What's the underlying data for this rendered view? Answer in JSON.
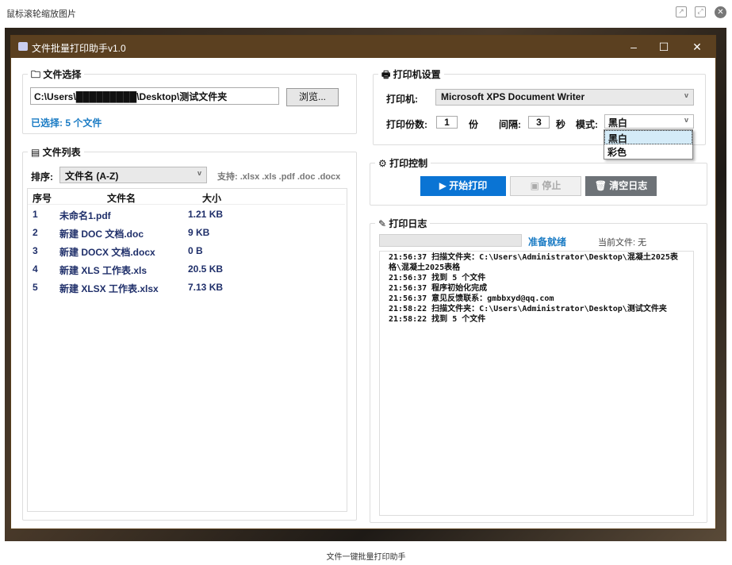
{
  "viewer": {
    "title": "鼠标滚轮缩放图片",
    "caption": "文件一键批量打印助手"
  },
  "window": {
    "title": "文件批量打印助手v1.0"
  },
  "file_select": {
    "label": "文件选择",
    "path": "C:\\Users\\█████████\\Desktop\\测试文件夹",
    "browse": "浏览...",
    "selected": "已选择: 5 个文件"
  },
  "file_list": {
    "label": "文件列表",
    "sort_label": "排序:",
    "sort_value": "文件名 (A-Z)",
    "support": "支持: .xlsx .xls .pdf .doc .docx",
    "columns": [
      "序号",
      "文件名",
      "大小"
    ],
    "rows": [
      [
        "1",
        "未命名1.pdf",
        "1.21 KB"
      ],
      [
        "2",
        "新建 DOC 文档.doc",
        "9 KB"
      ],
      [
        "3",
        "新建 DOCX 文档.docx",
        "0 B"
      ],
      [
        "4",
        "新建 XLS 工作表.xls",
        "20.5 KB"
      ],
      [
        "5",
        "新建 XLSX 工作表.xlsx",
        "7.13 KB"
      ]
    ]
  },
  "printer": {
    "label": "打印机设置",
    "printer_label": "打印机:",
    "printer_value": "Microsoft XPS Document Writer",
    "copies_label": "打印份数:",
    "copies": "1",
    "copies_unit": "份",
    "interval_label": "间隔:",
    "interval": "3",
    "interval_unit": "秒",
    "mode_label": "模式:",
    "mode_value": "黑白",
    "mode_options": [
      "黑白",
      "彩色"
    ]
  },
  "control": {
    "label": "打印控制",
    "start": "▶ 开始打印",
    "stop": "停止",
    "clear": "清空日志"
  },
  "log": {
    "label": "打印日志",
    "progress": 0,
    "status": "准备就绪",
    "current_file": "当前文件: 无",
    "lines": [
      "21:56:37 扫描文件夹：C:\\Users\\Administrator\\Desktop\\混凝土2025表\n格\\混凝土2025表格",
      "21:56:37 找到 5 个文件",
      "21:56:37 程序初始化完成",
      "21:56:37 意见反馈联系：gmbbxyd@qq.com",
      "21:58:22 扫描文件夹：C:\\Users\\Administrator\\Desktop\\测试文件夹",
      "21:58:22 找到 5 个文件"
    ]
  }
}
